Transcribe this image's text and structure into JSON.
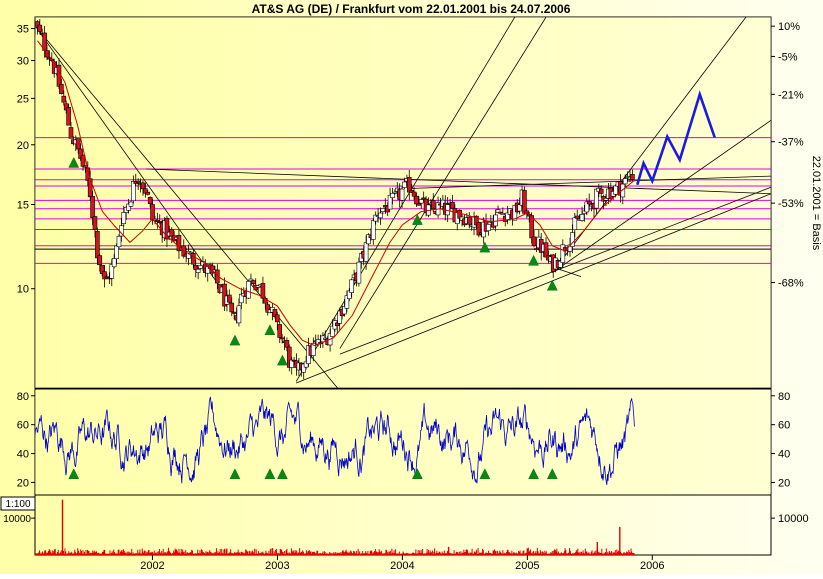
{
  "title": "AT&S AG (DE) / Frankfurt vom 22.01.2001 bis 24.07.2006",
  "right_axis_label": "22.01.2001 = Basis",
  "volume_scale_badge": "1:100",
  "colors": {
    "background": "#FFFFD0",
    "panel_fill": "#F7F7A8",
    "candle_down": "#D4141C",
    "candle_up": "#FFFFFF",
    "moving_average": "#CC0000",
    "resistance_lines": "#E000E0",
    "trend_lines": "#000000",
    "oscillator": "#0000CC",
    "projection": "#1A1AE0",
    "signal_marker": "#0A8A0A",
    "volume": "#E00000"
  },
  "chart_data": [
    {
      "type": "candlestick",
      "name": "price",
      "scale": "log",
      "ylim": [
        6.2,
        37
      ],
      "y_ticks": [
        10,
        15,
        20,
        25,
        30,
        35
      ],
      "right_ticks": [
        "10%",
        "-5%",
        "-21%",
        "-37%",
        "-53%",
        "-68%"
      ],
      "right_tick_prices": [
        35.4,
        30.6,
        25.5,
        20.3,
        15.1,
        10.3
      ],
      "x_range": [
        2001.06,
        2006.95
      ],
      "x_ticks": [
        "2002",
        "2003",
        "2004",
        "2005",
        "2006"
      ],
      "x_tick_values": [
        2002.0,
        2003.0,
        2004.0,
        2005.0,
        2006.0
      ],
      "close_path": [
        [
          2001.06,
          35.5
        ],
        [
          2001.12,
          33
        ],
        [
          2001.2,
          30
        ],
        [
          2001.28,
          25
        ],
        [
          2001.35,
          21
        ],
        [
          2001.42,
          19
        ],
        [
          2001.5,
          16
        ],
        [
          2001.56,
          12
        ],
        [
          2001.62,
          10.2
        ],
        [
          2001.7,
          11.5
        ],
        [
          2001.75,
          14
        ],
        [
          2001.82,
          15.5
        ],
        [
          2001.88,
          17.5
        ],
        [
          2001.95,
          16
        ],
        [
          2002.0,
          14
        ],
        [
          2002.08,
          13.5
        ],
        [
          2002.17,
          12.5
        ],
        [
          2002.25,
          12
        ],
        [
          2002.33,
          11.5
        ],
        [
          2002.42,
          11
        ],
        [
          2002.5,
          10.5
        ],
        [
          2002.58,
          9.5
        ],
        [
          2002.65,
          8.5
        ],
        [
          2002.72,
          9.8
        ],
        [
          2002.8,
          10.5
        ],
        [
          2002.87,
          10
        ],
        [
          2002.95,
          9
        ],
        [
          2003.0,
          8.2
        ],
        [
          2003.05,
          7.8
        ],
        [
          2003.1,
          7
        ],
        [
          2003.16,
          6.6
        ],
        [
          2003.22,
          7.2
        ],
        [
          2003.3,
          7.6
        ],
        [
          2003.38,
          7.8
        ],
        [
          2003.46,
          8.5
        ],
        [
          2003.55,
          9.5
        ],
        [
          2003.62,
          10.5
        ],
        [
          2003.7,
          12
        ],
        [
          2003.8,
          14.5
        ],
        [
          2003.9,
          15
        ],
        [
          2004.0,
          16
        ],
        [
          2004.06,
          16.5
        ],
        [
          2004.12,
          15.5
        ],
        [
          2004.2,
          14.5
        ],
        [
          2004.3,
          14.8
        ],
        [
          2004.4,
          14.5
        ],
        [
          2004.5,
          14.2
        ],
        [
          2004.6,
          13.5
        ],
        [
          2004.68,
          13.6
        ],
        [
          2004.76,
          14.3
        ],
        [
          2004.84,
          14.5
        ],
        [
          2004.9,
          14.4
        ],
        [
          2004.96,
          15.5
        ],
        [
          2005.0,
          14
        ],
        [
          2005.06,
          12.5
        ],
        [
          2005.12,
          12.2
        ],
        [
          2005.18,
          11.2
        ],
        [
          2005.24,
          11.5
        ],
        [
          2005.3,
          12.3
        ],
        [
          2005.38,
          13.5
        ],
        [
          2005.46,
          14.5
        ],
        [
          2005.55,
          15.5
        ],
        [
          2005.65,
          16
        ],
        [
          2005.72,
          16.2
        ],
        [
          2005.78,
          16.7
        ],
        [
          2005.85,
          17.5
        ]
      ],
      "moving_average": [
        [
          2001.08,
          33
        ],
        [
          2001.2,
          30
        ],
        [
          2001.3,
          27
        ],
        [
          2001.4,
          22
        ],
        [
          2001.5,
          17
        ],
        [
          2001.6,
          14.5
        ],
        [
          2001.7,
          13.5
        ],
        [
          2001.82,
          12.5
        ],
        [
          2001.92,
          13.2
        ],
        [
          2002.0,
          14
        ],
        [
          2002.1,
          13
        ],
        [
          2002.25,
          12
        ],
        [
          2002.4,
          11.4
        ],
        [
          2002.55,
          10.5
        ],
        [
          2002.7,
          10
        ],
        [
          2002.85,
          9.7
        ],
        [
          2003.0,
          9.2
        ],
        [
          2003.1,
          8.4
        ],
        [
          2003.2,
          7.8
        ],
        [
          2003.3,
          7.6
        ],
        [
          2003.45,
          7.9
        ],
        [
          2003.6,
          8.8
        ],
        [
          2003.75,
          10.5
        ],
        [
          2003.9,
          12.5
        ],
        [
          2004.0,
          13.6
        ],
        [
          2004.15,
          14.5
        ],
        [
          2004.3,
          14.7
        ],
        [
          2004.5,
          14.3
        ],
        [
          2004.7,
          13.8
        ],
        [
          2004.9,
          14
        ],
        [
          2005.0,
          14.4
        ],
        [
          2005.1,
          13.6
        ],
        [
          2005.2,
          12.3
        ],
        [
          2005.3,
          12
        ],
        [
          2005.45,
          13.2
        ],
        [
          2005.6,
          14.8
        ],
        [
          2005.75,
          16
        ],
        [
          2005.85,
          16.8
        ]
      ],
      "resistance_levels": [
        20.7,
        17.8,
        16.9,
        16.4,
        15.3,
        14.7,
        14,
        13.3,
        12.3,
        11.3
      ],
      "support_line": 12.1,
      "trend_lines": [
        [
          [
            2001.06,
            35.5
          ],
          [
            2003.55,
            5.9
          ]
        ],
        [
          [
            2001.06,
            35.5
          ],
          [
            2002.65,
            9.2
          ]
        ],
        [
          [
            2001.95,
            17.8
          ],
          [
            2006.95,
            15.8
          ]
        ],
        [
          [
            2003.15,
            6.35
          ],
          [
            2006.95,
            15.8
          ]
        ],
        [
          [
            2003.5,
            7.3
          ],
          [
            2006.95,
            16.3
          ]
        ],
        [
          [
            2005.2,
            10.8
          ],
          [
            2006.95,
            22.5
          ]
        ],
        [
          [
            2005.3,
            11.7
          ],
          [
            2006.75,
            37
          ]
        ],
        [
          [
            2003.15,
            6.4
          ],
          [
            2004.9,
            37
          ]
        ],
        [
          [
            2003.5,
            7.5
          ],
          [
            2005.15,
            37
          ]
        ],
        [
          [
            2004.05,
            16.2
          ],
          [
            2006.95,
            17.2
          ]
        ],
        [
          [
            2005.2,
            11.1
          ],
          [
            2005.43,
            10.6
          ]
        ]
      ],
      "projection": [
        [
          2005.88,
          16.5
        ],
        [
          2005.93,
          18.3
        ],
        [
          2006.0,
          16.8
        ],
        [
          2006.12,
          20.8
        ],
        [
          2006.22,
          18.6
        ],
        [
          2006.38,
          25.5
        ],
        [
          2006.5,
          20.7
        ]
      ],
      "signal_markers": [
        2001.37,
        2002.66,
        2002.94,
        2003.04,
        2004.12,
        2004.66,
        2005.05,
        2005.2
      ]
    },
    {
      "type": "line",
      "name": "oscillator",
      "ylim": [
        12,
        84
      ],
      "y_ticks": [
        20,
        40,
        60,
        80
      ],
      "signal_markers": [
        2001.37,
        2002.66,
        2002.94,
        2003.04,
        2004.12,
        2004.66,
        2005.05,
        2005.2
      ]
    },
    {
      "type": "bar",
      "name": "volume",
      "ylim": [
        0,
        16000
      ],
      "y_ticks": [
        10000
      ],
      "spikes": [
        [
          2001.28,
          15000
        ],
        [
          2004.37,
          2200
        ],
        [
          2005.56,
          3500
        ],
        [
          2005.74,
          7600
        ],
        [
          2005.0,
          1800
        ]
      ]
    }
  ]
}
